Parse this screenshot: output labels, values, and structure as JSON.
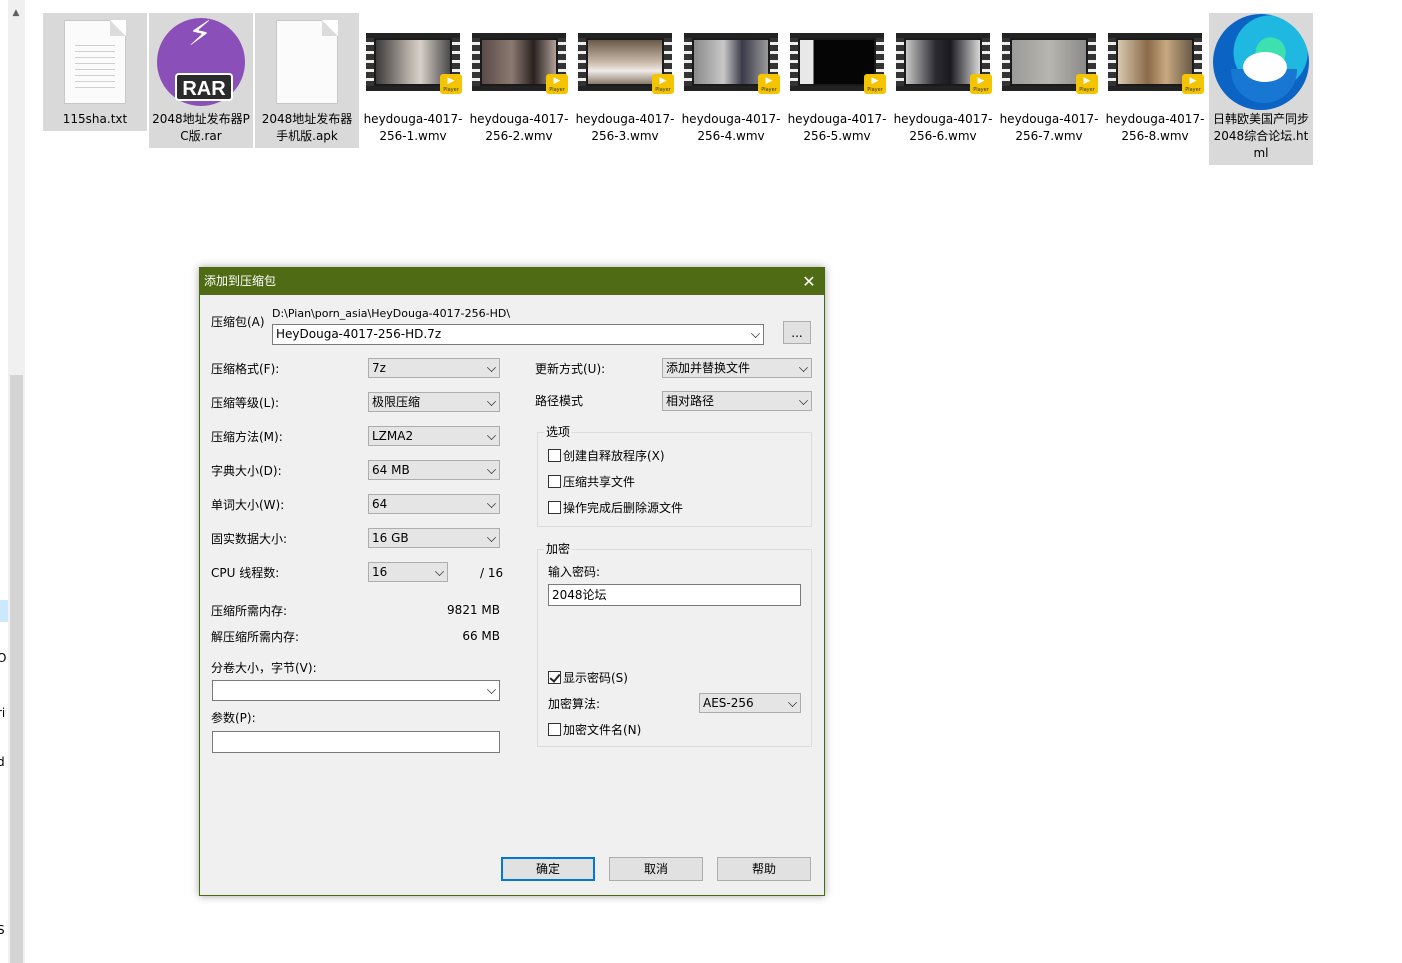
{
  "explorer": {
    "files": [
      {
        "name": "115sha.txt",
        "icon": "text-file-icon",
        "selected": true
      },
      {
        "name": "2048地址发布器PC版.rar",
        "icon": "rar-archive-icon",
        "selected": true
      },
      {
        "name": "2048地址发布器手机版.apk",
        "icon": "blank-file-icon",
        "selected": true
      },
      {
        "name": "heydouga-4017-256-1.wmv",
        "icon": "video-file-icon",
        "selected": false
      },
      {
        "name": "heydouga-4017-256-2.wmv",
        "icon": "video-file-icon",
        "selected": false
      },
      {
        "name": "heydouga-4017-256-3.wmv",
        "icon": "video-file-icon",
        "selected": false
      },
      {
        "name": "heydouga-4017-256-4.wmv",
        "icon": "video-file-icon",
        "selected": false
      },
      {
        "name": "heydouga-4017-256-5.wmv",
        "icon": "video-file-icon",
        "selected": false
      },
      {
        "name": "heydouga-4017-256-6.wmv",
        "icon": "video-file-icon",
        "selected": false
      },
      {
        "name": "heydouga-4017-256-7.wmv",
        "icon": "video-file-icon",
        "selected": false
      },
      {
        "name": "heydouga-4017-256-8.wmv",
        "icon": "video-file-icon",
        "selected": false
      },
      {
        "name": "日韩欧美国产同步 2048综合论坛.html",
        "icon": "edge-html-icon",
        "selected": true
      }
    ],
    "badge_glyph": "▶",
    "badge_text": "Player",
    "rar_label": "RAR",
    "left_clip_texts": [
      "Or",
      "riv",
      "d",
      "S"
    ]
  },
  "dialog": {
    "title": "添加到压缩包",
    "close_glyph": "✕",
    "archive_label": "压缩包(A)",
    "archive_path": "D:\\Pian\\porn_asia\\HeyDouga-4017-256-HD\\",
    "archive_name": "HeyDouga-4017-256-HD.7z",
    "browse_label": "...",
    "format_label": "压缩格式(F):",
    "format_value": "7z",
    "level_label": "压缩等级(L):",
    "level_value": "极限压缩",
    "method_label": "压缩方法(M):",
    "method_value": "LZMA2",
    "dict_label": "字典大小(D):",
    "dict_value": "64 MB",
    "word_label": "单词大小(W):",
    "word_value": "64",
    "solid_label": "固实数据大小:",
    "solid_value": "16 GB",
    "cpu_label": "CPU 线程数:",
    "cpu_value": "16",
    "cpu_total": "/ 16",
    "mem_comp_label": "压缩所需内存:",
    "mem_comp_value": "9821 MB",
    "mem_decomp_label": "解压缩所需内存:",
    "mem_decomp_value": "66 MB",
    "volume_label": "分卷大小，字节(V):",
    "volume_value": "",
    "params_label": "参数(P):",
    "params_value": "",
    "update_label": "更新方式(U):",
    "update_value": "添加并替换文件",
    "path_label": "路径模式",
    "path_value": "相对路径",
    "options_title": "选项",
    "opt_sfx": "创建自释放程序(X)",
    "opt_shared": "压缩共享文件",
    "opt_delete": "操作完成后删除源文件",
    "encrypt_title": "加密",
    "password_label": "输入密码:",
    "password_value": "2048论坛",
    "show_password": "显示密码(S)",
    "enc_method_label": "加密算法:",
    "enc_method_value": "AES-256",
    "encrypt_names": "加密文件名(N)",
    "ok": "确定",
    "cancel": "取消",
    "help": "帮助"
  }
}
